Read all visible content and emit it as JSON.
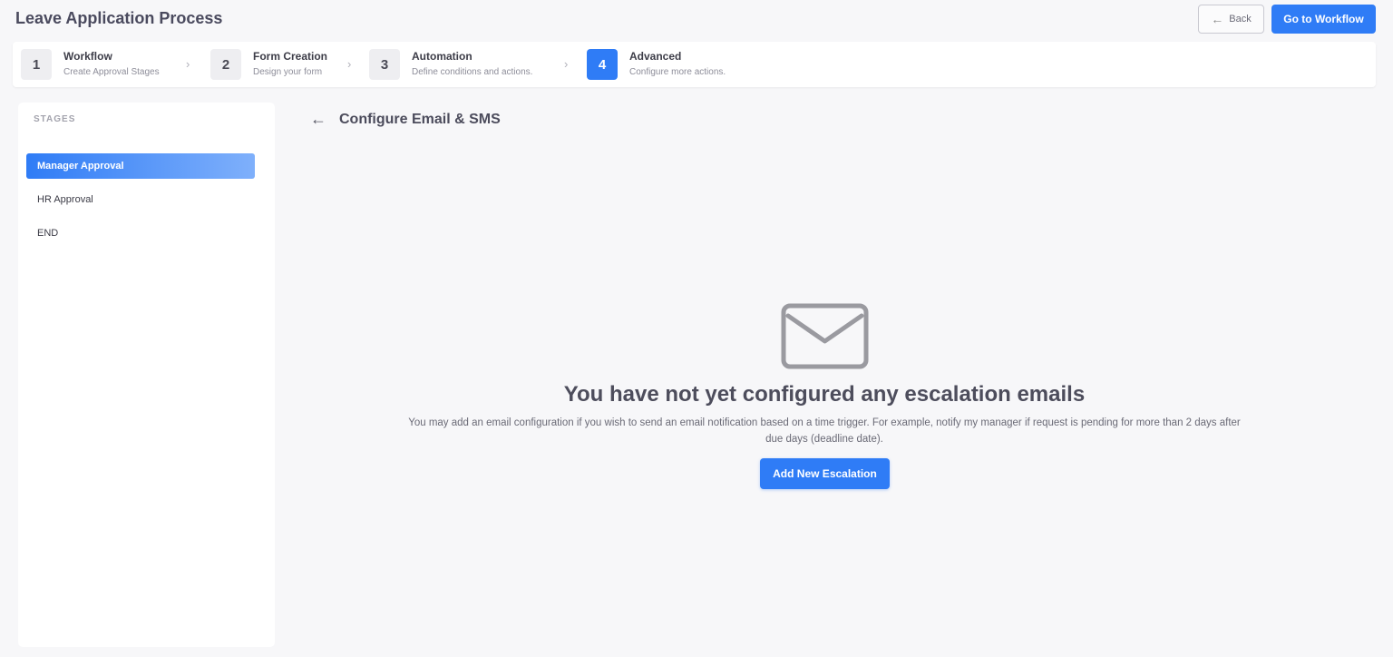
{
  "header": {
    "title": "Leave Application Process",
    "back_label": "Back",
    "go_to_workflow_label": "Go to Workflow"
  },
  "stepper": {
    "steps": [
      {
        "number": "1",
        "title": "Workflow",
        "subtitle": "Create Approval Stages",
        "active": false
      },
      {
        "number": "2",
        "title": "Form Creation",
        "subtitle": "Design your form",
        "active": false
      },
      {
        "number": "3",
        "title": "Automation",
        "subtitle": "Define conditions and actions.",
        "active": false
      },
      {
        "number": "4",
        "title": "Advanced",
        "subtitle": "Configure more actions.",
        "active": true
      }
    ]
  },
  "sidebar": {
    "heading": "STAGES",
    "items": [
      {
        "label": "Manager Approval",
        "active": true
      },
      {
        "label": "HR Approval",
        "active": false
      },
      {
        "label": "END",
        "active": false
      }
    ]
  },
  "main": {
    "title": "Configure Email & SMS",
    "empty_icon": "envelope-icon",
    "empty_title": "You have not yet configured any escalation emails",
    "empty_description": "You may add an email configuration if you wish to send an email notification based on a time trigger. For example, notify my manager if request is pending for more than 2 days after due days (deadline date).",
    "add_button_label": "Add New Escalation"
  },
  "colors": {
    "accent": "#2f7cf6",
    "background": "#f7f7f9",
    "icon_gray": "#9a9aa0"
  }
}
